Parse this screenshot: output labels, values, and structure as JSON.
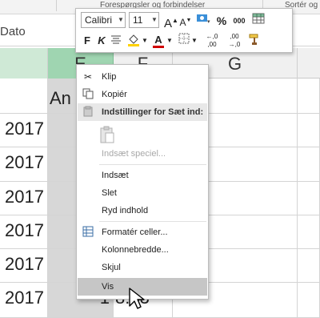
{
  "ribbon": {
    "group_queries": "Forespørgsler og forbindelser",
    "group_sort": "Sortér og"
  },
  "formula_bar": {
    "text": "Dato"
  },
  "columns": {
    "e": "E",
    "f": "F",
    "g": "G"
  },
  "rows": [
    {
      "date": "",
      "e": "An",
      "f": ""
    },
    {
      "date": "2017",
      "e": "",
      "f": ""
    },
    {
      "date": "2017",
      "e": "",
      "f": ""
    },
    {
      "date": "2017",
      "e": "",
      "f": ""
    },
    {
      "date": "2017",
      "e": "",
      "f": ""
    },
    {
      "date": "2017",
      "e": "",
      "f": ""
    },
    {
      "date": "2017",
      "e": "1",
      "f": "8:43"
    }
  ],
  "mini_toolbar": {
    "font_name": "Calibri",
    "font_size": "11",
    "grow_font": "A",
    "shrink_font": "A",
    "percent": "%",
    "thousands": "000",
    "bold": "F",
    "italic": "K",
    "font_color_letter": "A",
    "increase_decimals": "←,0 ,00",
    "decrease_decimals": ",00 →,0"
  },
  "context_menu": {
    "cut": "Klip",
    "copy": "Kopiér",
    "paste_options_header": "Indstillinger for Sæt ind:",
    "paste_special": "Indsæt speciel...",
    "insert": "Indsæt",
    "delete": "Slet",
    "clear_contents": "Ryd indhold",
    "format_cells": "Formatér celler...",
    "column_width": "Kolonnebredde...",
    "hide": "Skjul",
    "unhide": "Vis"
  },
  "colors": {
    "header_selected": "#9fd5b1",
    "cell_selected": "#d7d7d7",
    "menu_hover": "#c6c6c6",
    "fill_yellow": "#ffd200",
    "font_red": "#d00000"
  }
}
